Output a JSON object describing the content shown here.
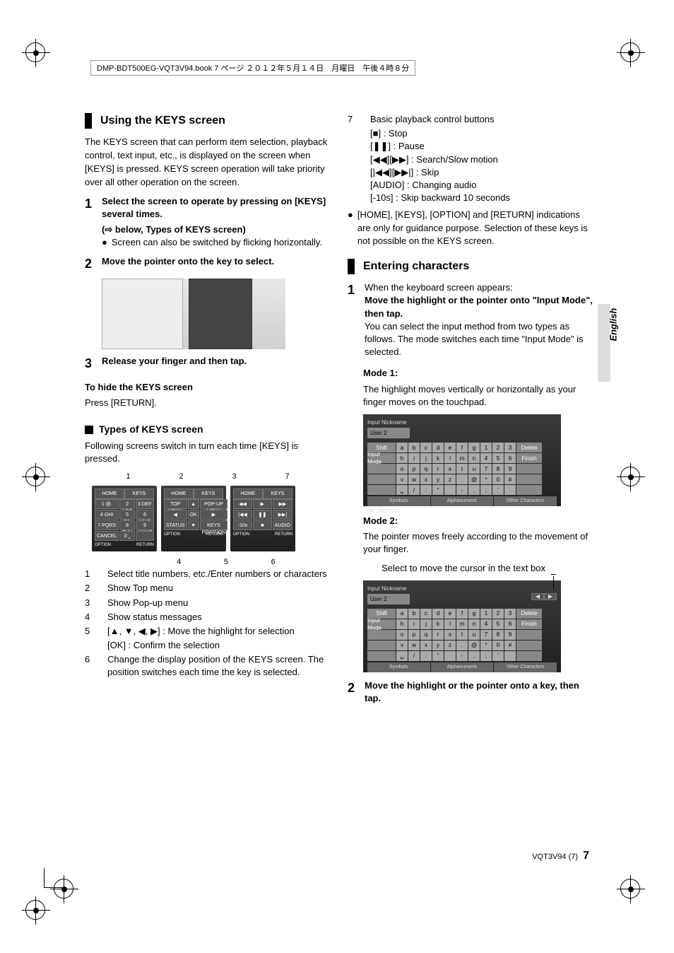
{
  "page_header": "DMP-BDT500EG-VQT3V94.book  7 ページ  ２０１２年５月１４日　月曜日　午後４時８分",
  "side_label": "English",
  "footer": {
    "code": "VQT3V94",
    "paren": "(7)",
    "page_num": "7"
  },
  "left": {
    "heading": "Using the KEYS screen",
    "intro": "The KEYS screen that can perform item selection, playback control, text input, etc., is displayed on the screen when [KEYS] is pressed. KEYS screen operation will take priority over all other operation on the screen.",
    "step1": {
      "num": "1",
      "title": "Select the screen to operate by pressing on [KEYS] several times.",
      "sub": "(⇨ below, Types of KEYS screen)",
      "bullet": "Screen can also be switched by flicking horizontally."
    },
    "step2": {
      "num": "2",
      "title": "Move the pointer onto the key to select."
    },
    "step3": {
      "num": "3",
      "title": "Release your finger and then tap."
    },
    "hide_title": "To hide the KEYS screen",
    "hide_text": "Press [RETURN].",
    "types_heading": "Types of KEYS screen",
    "types_intro": "Following screens switch in turn each time [KEYS] is pressed.",
    "num_labels": [
      "1",
      "2",
      "3",
      "7"
    ],
    "panel1": {
      "hdr_l": "HOME",
      "hdr_r": "KEYS",
      "keys": [
        "1 @.",
        "2 ABC",
        "3 DEF",
        "4 GHI",
        "5 JKL",
        "6 MNO",
        "7 PQRS",
        "8 TUV",
        "9 WXYZ",
        "CANCEL",
        "0 ˽",
        ""
      ],
      "bot_l": "OPTION",
      "bot_r": "RETURN"
    },
    "panel2": {
      "hdr_l": "HOME",
      "hdr_r": "KEYS",
      "keys": [
        "TOP MENU",
        "▲",
        "POP-UP MENU",
        "◀",
        "OK",
        "▶",
        "STATUS",
        "▼",
        "KEYS POSITION"
      ],
      "bot_l": "OPTION",
      "bot_r": "RETURN"
    },
    "panel3": {
      "hdr_l": "HOME",
      "hdr_r": "KEYS",
      "keys": [
        "◀◀",
        "▶",
        "▶▶",
        "|◀◀",
        "❚❚",
        "▶▶|",
        "-10s",
        "■",
        "AUDIO"
      ],
      "bot_l": "OPTION",
      "bot_r": "RETURN"
    },
    "bottom_labels": [
      "4",
      "5",
      "6"
    ],
    "list": [
      {
        "n": "1",
        "t": "Select title numbers, etc./Enter numbers or characters"
      },
      {
        "n": "2",
        "t": "Show Top menu"
      },
      {
        "n": "3",
        "t": "Show Pop-up menu"
      },
      {
        "n": "4",
        "t": "Show status messages"
      },
      {
        "n": "5",
        "t": "[▲, ▼, ◀, ▶] : Move the highlight for selection"
      },
      {
        "n": "",
        "t": "[OK] : Confirm the selection"
      },
      {
        "n": "6",
        "t": "Change the display position of the KEYS screen. The position switches each time the key is selected."
      }
    ]
  },
  "right": {
    "list7": {
      "n": "7",
      "intro": "Basic playback control buttons",
      "lines": [
        "[■] : Stop",
        "[❚❚] : Pause",
        "[◀◀][▶▶] : Search/Slow motion",
        "[|◀◀][▶▶|] : Skip",
        "[AUDIO] : Changing audio",
        "[-10s] : Skip backward 10 seconds"
      ]
    },
    "note_bullet": "[HOME], [KEYS], [OPTION] and [RETURN] indications are only for guidance purpose. Selection of these keys is not possible on the KEYS screen.",
    "heading2": "Entering characters",
    "step1": {
      "num": "1",
      "intro": "When the keyboard screen appears:",
      "title": "Move the highlight or the pointer onto \"Input Mode\", then tap.",
      "body": "You can select the input method from two types as follows. The mode switches each time \"Input Mode\" is selected."
    },
    "mode1": {
      "label": "Mode 1:",
      "text": "The highlight moves vertically or horizontally as your finger moves on the touchpad."
    },
    "kb1": {
      "title": "Input Nickname",
      "value": "User 2",
      "rows": [
        {
          "side": "Shift",
          "keys": [
            "a",
            "b",
            "c",
            "d",
            "e",
            "f",
            "g",
            "1",
            "2",
            "3"
          ],
          "end": "Delete"
        },
        {
          "side": "Input Mode",
          "keys": [
            "h",
            "i",
            "j",
            "k",
            "l",
            "m",
            "n",
            "4",
            "5",
            "6"
          ],
          "end": "Finish"
        },
        {
          "side": "",
          "keys": [
            "o",
            "p",
            "q",
            "r",
            "s",
            "t",
            "u",
            "7",
            "8",
            "9"
          ],
          "end": ""
        },
        {
          "side": "",
          "keys": [
            "v",
            "w",
            "x",
            "y",
            "z",
            ".",
            "@",
            "*",
            "0",
            "#"
          ],
          "end": ""
        },
        {
          "side": "",
          "keys": [
            "␣",
            "/",
            ":",
            "\"",
            "",
            "-",
            ",",
            ";",
            "'",
            ""
          ],
          "end": ""
        }
      ],
      "segments": [
        "Symbols",
        "Alphanumeric",
        "Other Characters"
      ],
      "ok": "OK",
      "return": "RETURN"
    },
    "mode2": {
      "label": "Mode 2:",
      "text": "The pointer moves freely according to the movement of your finger.",
      "caption": "Select to move the cursor in the text box"
    },
    "kb2": {
      "title": "Input Nickname",
      "value": "User 2",
      "nav_l": "◀",
      "nav_r": "▶",
      "rows": [
        {
          "side": "Shift",
          "keys": [
            "a",
            "b",
            "c",
            "d",
            "e",
            "f",
            "g",
            "1",
            "2",
            "3"
          ],
          "end": "Delete"
        },
        {
          "side": "Input Mode",
          "keys": [
            "h",
            "i",
            "j",
            "k",
            "l",
            "m",
            "n",
            "4",
            "5",
            "6"
          ],
          "end": "Finish"
        },
        {
          "side": "",
          "keys": [
            "o",
            "p",
            "q",
            "r",
            "s",
            "t",
            "u",
            "7",
            "8",
            "9"
          ],
          "end": ""
        },
        {
          "side": "",
          "keys": [
            "v",
            "w",
            "x",
            "y",
            "z",
            ".",
            "@",
            "*",
            "0",
            "#"
          ],
          "end": ""
        },
        {
          "side": "",
          "keys": [
            "␣",
            "/",
            ":",
            "\"",
            "",
            "-",
            ",",
            ";",
            "'",
            ""
          ],
          "end": ""
        }
      ],
      "segments": [
        "Symbols",
        "Alphanumeric",
        "Other Characters"
      ]
    },
    "step2": {
      "num": "2",
      "title": "Move the highlight or the pointer onto a key, then tap."
    }
  }
}
